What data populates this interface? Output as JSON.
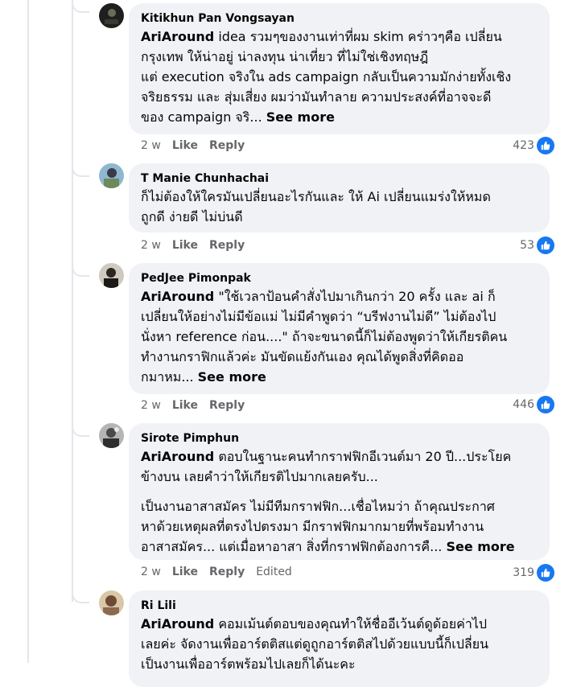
{
  "comments": [
    {
      "author": "Kitikhun Pan Vongsayan",
      "mention": "AriAround",
      "lines": [
        " idea รวมๆของงานเท่าที่ผม skim คร่าวๆคือ เปลี่ยน",
        "กรุงเทพ ให้น่าอยู่ น่าลงทุน น่าเที่ยว ที่ไม่ใช่เชิงทฤษฎี",
        "แต่ execution จริงใน ads campaign กลับเป็นความมักง่ายทั้งเชิง",
        "จริยธรรม และ สุ่มเสี่ยง ผมว่ามันทำลาย ความประสงค์ที่อาจจะดี",
        "ของ campaign จริ... "
      ],
      "see_more": "See more",
      "time": "2 w",
      "like": "Like",
      "reply": "Reply",
      "reactions": "423"
    },
    {
      "author": "T Manie Chunhachai",
      "lines": [
        "ก็ไม่ต้องให้ใครมันเปลี่ยนอะไรกันและ ให้ Ai เปลี่ยนแมร่งให้หมด",
        "ถูกดี ง่ายดี ไม่บ่นดี"
      ],
      "time": "2 w",
      "like": "Like",
      "reply": "Reply",
      "reactions": "53"
    },
    {
      "author": "PedJee Pimonpak",
      "mention": "AriAround",
      "lines": [
        " \"ใช้เวลาป้อนคำสั่งไปมาเกินกว่า 20 ครั้ง และ ai ก็",
        "เปลี่ยนให้อย่างไม่มีข้อแม่ ไม่มีคำพูดว่า “บรีฟงานไม่ดี” ไม่ต้องไป",
        "นั่งหา reference ก่อน....\" ถ้าจะขนาดนี้ก็ไม่ต้องพูดว่าให้เกียรติคน",
        "ทำงานกราฟิกแล้วค่ะ มันขัดแย้งกันเอง คุณได้พูดสิ่งที่คิดออ",
        "กมาหม... "
      ],
      "see_more": "See more",
      "time": "2 w",
      "like": "Like",
      "reply": "Reply",
      "reactions": "446"
    },
    {
      "author": "Sirote Pimphun",
      "mention": "AriAround",
      "lines": [
        " ตอบในฐานะคนทำกราฟฟิกอีเวนต์มา 20 ปี...ประโยค",
        "ข้างบน เลยคำว่าให้เกียรติไปมากเลยครับ..."
      ],
      "lines2": [
        "เป็นงานอาสาสมัคร ไม่มีทีมกราฟฟิก...เชื่อไหมว่า ถ้าคุณประกาศ",
        "หาด้วยเหตุผลที่ตรงไปตรงมา มีกราฟฟิกมากมายที่พร้อมทำงาน",
        "อาสาสมัคร... แต่เมื่อหาอาสา สิ่งที่กราฟฟิกต้องการคื... "
      ],
      "see_more": "See more",
      "time": "2 w",
      "like": "Like",
      "reply": "Reply",
      "edited": "Edited",
      "reactions": "319"
    },
    {
      "author": "Ri Lili",
      "mention": "AriAround",
      "lines": [
        " คอมเม้นต์ตอบของคุณทำให้ชื่ออีเว้นต์ดูด้อยค่าไป",
        "เลยค่ะ จัดงานเพื่ออาร์ตติสแต่ดูถูกอาร์ตติสไปด้วยแบบนี้ก็เปลี่ยน",
        "เป็นงานเพื่ออาร์ตพร้อมไปเลยก็ได้นะคะ"
      ]
    }
  ],
  "icons": {
    "like": "thumbs-up-icon"
  },
  "colors": {
    "bubble": "#f0f2f5",
    "meta": "#65676b",
    "like_blue": "#1877f2"
  }
}
